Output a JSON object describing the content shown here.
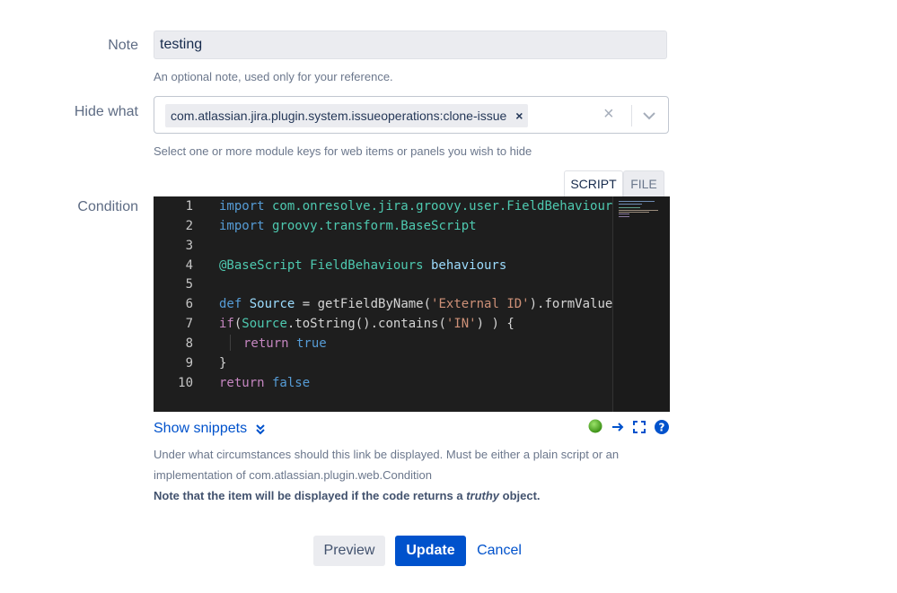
{
  "note": {
    "label": "Note",
    "value": "testing",
    "help": "An optional note, used only for your reference."
  },
  "hide_what": {
    "label": "Hide what",
    "selected": "com.atlassian.jira.plugin.system.issueoperations:clone-issue",
    "chip_remove": "×",
    "clear": "×",
    "help": "Select one or more module keys for web items or panels you wish to hide"
  },
  "condition": {
    "label": "Condition",
    "tabs": [
      {
        "label": "SCRIPT",
        "active": true
      },
      {
        "label": "FILE",
        "active": false
      }
    ],
    "line_numbers": [
      "1",
      "2",
      "3",
      "4",
      "5",
      "6",
      "7",
      "8",
      "9",
      "10"
    ],
    "code": {
      "l1_kw": "import",
      "l1_rest": " com.onresolve.jira.groovy.user.FieldBehaviours",
      "l2_kw": "import",
      "l2_rest": " groovy.transform.BaseScript",
      "l4_anno": "@BaseScript",
      "l4_cls": " FieldBehaviours",
      "l4_var": " behaviours",
      "l6_kw": "def",
      "l6_var": " Source",
      "l6_mid": " = getFieldByName(",
      "l6_str": "'External ID'",
      "l6_end": ").formValue",
      "l7_kw": "if",
      "l7_open": "(",
      "l7_var": "Source",
      "l7_mid": ".toString().contains(",
      "l7_str": "'IN'",
      "l7_end": ") ) {",
      "l8_kw": "return",
      "l8_val": " true",
      "l9": "}",
      "l10_kw": "return",
      "l10_val": " false"
    },
    "show_snippets": "Show snippets",
    "help_line1": "Under what circumstances should this link be displayed. Must be either a plain script or an",
    "help_line2": "implementation of com.atlassian.plugin.web.Condition",
    "note_pre": "Note that the item will be displayed if the code returns a ",
    "note_em": "truthy",
    "note_post": " object."
  },
  "buttons": {
    "preview": "Preview",
    "update": "Update",
    "cancel": "Cancel"
  },
  "colors": {
    "primary": "#0052cc",
    "status_ok": "#4caf1f"
  }
}
